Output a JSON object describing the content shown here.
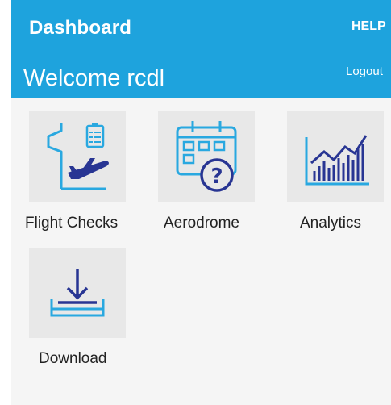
{
  "header": {
    "title": "Dashboard",
    "help_label": "HELP",
    "welcome": "Welcome rcdl",
    "logout_label": "Logout"
  },
  "tiles": [
    {
      "label": "Flight Checks",
      "icon": "flight-checks-icon"
    },
    {
      "label": "Aerodrome",
      "icon": "aerodrome-calendar-question-icon"
    },
    {
      "label": "Analytics",
      "icon": "analytics-chart-icon"
    },
    {
      "label": "Download",
      "icon": "download-tray-icon"
    }
  ],
  "colors": {
    "header": "#1ea3dd",
    "icon_dark": "#283593",
    "icon_light": "#29a8e0",
    "tile_bg": "#e8e8e8",
    "page_bg": "#f5f5f5"
  }
}
